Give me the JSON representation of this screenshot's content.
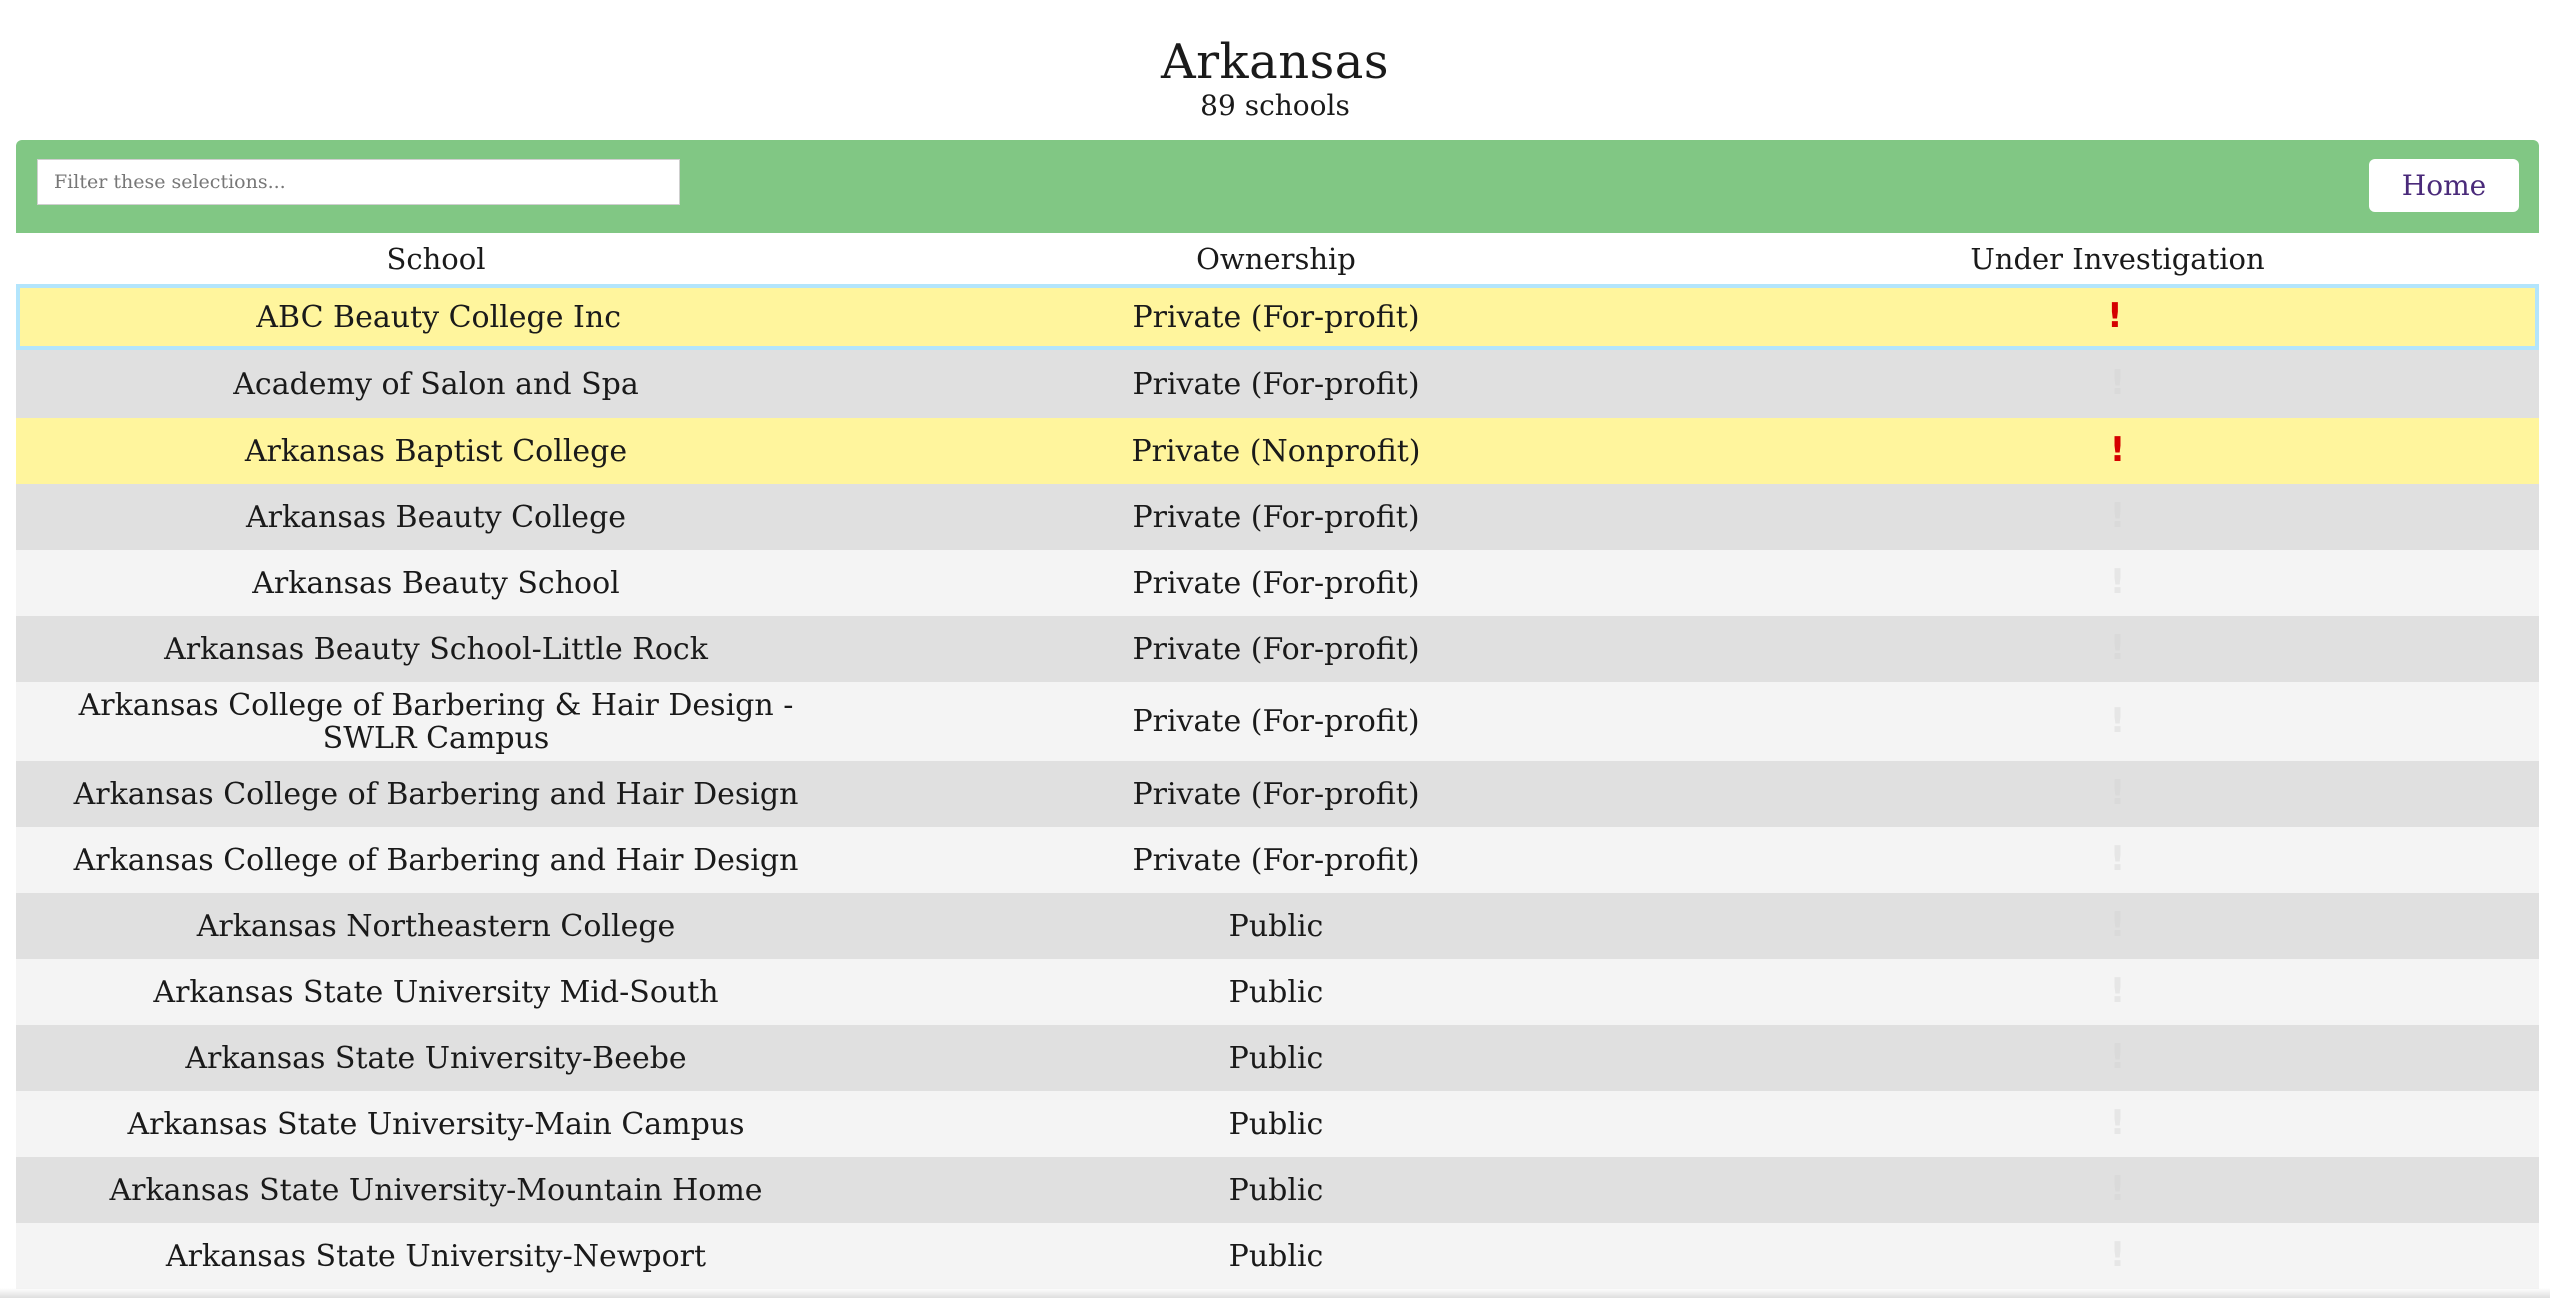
{
  "header": {
    "title": "Arkansas",
    "count": "89 schools"
  },
  "toolbar": {
    "filter_placeholder": "Filter these selections...",
    "home_label": "Home"
  },
  "table": {
    "columns": [
      "School",
      "Ownership",
      "Under Investigation"
    ],
    "investigation_glyph": "!",
    "rows": [
      {
        "school": "ABC Beauty College Inc",
        "ownership": "Private (For-profit)",
        "investigated": true
      },
      {
        "school": "Academy of Salon and Spa",
        "ownership": "Private (For-profit)",
        "investigated": false
      },
      {
        "school": "Arkansas Baptist College",
        "ownership": "Private (Nonprofit)",
        "investigated": true
      },
      {
        "school": "Arkansas Beauty College",
        "ownership": "Private (For-profit)",
        "investigated": false
      },
      {
        "school": "Arkansas Beauty School",
        "ownership": "Private (For-profit)",
        "investigated": false
      },
      {
        "school": "Arkansas Beauty School-Little Rock",
        "ownership": "Private (For-profit)",
        "investigated": false
      },
      {
        "school": "Arkansas College of Barbering & Hair Design - SWLR Campus",
        "ownership": "Private (For-profit)",
        "investigated": false
      },
      {
        "school": "Arkansas College of Barbering and Hair Design",
        "ownership": "Private (For-profit)",
        "investigated": false
      },
      {
        "school": "Arkansas College of Barbering and Hair Design",
        "ownership": "Private (For-profit)",
        "investigated": false
      },
      {
        "school": "Arkansas Northeastern College",
        "ownership": "Public",
        "investigated": false
      },
      {
        "school": "Arkansas State University Mid-South",
        "ownership": "Public",
        "investigated": false
      },
      {
        "school": "Arkansas State University-Beebe",
        "ownership": "Public",
        "investigated": false
      },
      {
        "school": "Arkansas State University-Main Campus",
        "ownership": "Public",
        "investigated": false
      },
      {
        "school": "Arkansas State University-Mountain Home",
        "ownership": "Public",
        "investigated": false
      },
      {
        "school": "Arkansas State University-Newport",
        "ownership": "Public",
        "investigated": false
      }
    ]
  },
  "colors": {
    "toolbar": "#81c784",
    "highlight_row": "#fff59d",
    "alarm": "#d50000"
  }
}
